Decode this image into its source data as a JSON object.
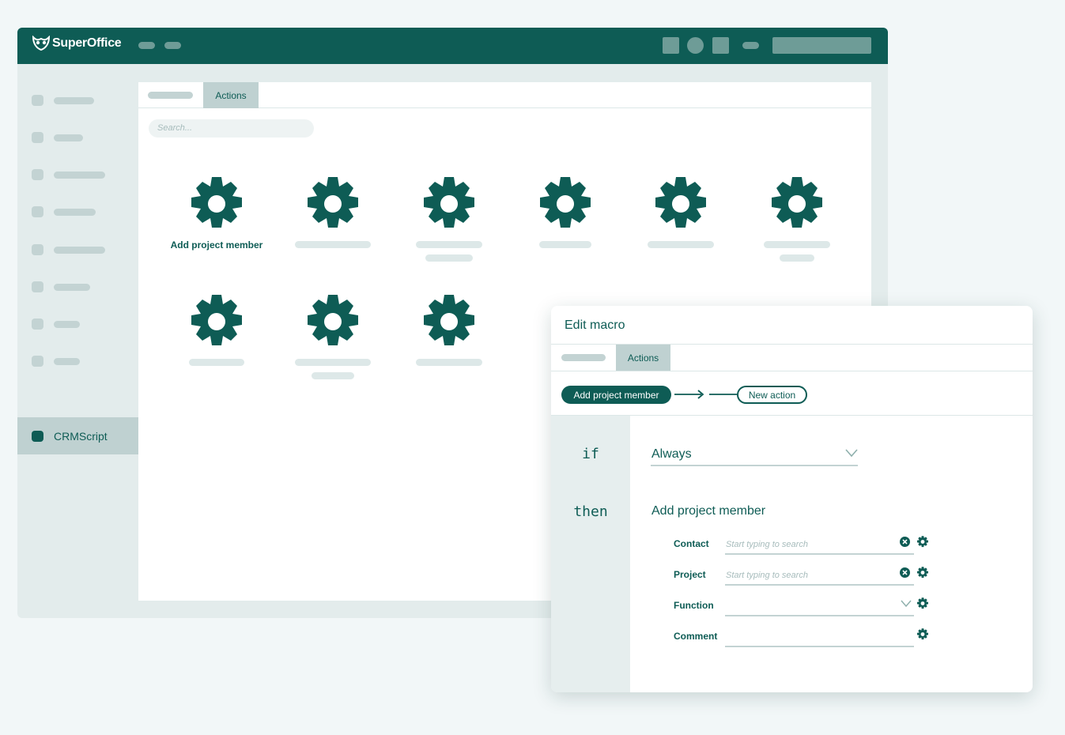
{
  "app": {
    "brand": "SuperOffice"
  },
  "sidebar": {
    "active_item": "CRMScript"
  },
  "main": {
    "tab_active": "Actions",
    "search_placeholder": "Search...",
    "tiles": [
      {
        "label": "Add project member"
      }
    ]
  },
  "dialog": {
    "title": "Edit macro",
    "tab_active": "Actions",
    "flow": {
      "current": "Add project member",
      "next": "New action"
    },
    "condition": {
      "keyword": "if",
      "value": "Always"
    },
    "action": {
      "keyword": "then",
      "title": "Add project member",
      "fields": [
        {
          "label": "Contact",
          "placeholder": "Start typing to search"
        },
        {
          "label": "Project",
          "placeholder": "Start typing to search"
        },
        {
          "label": "Function",
          "placeholder": ""
        },
        {
          "label": "Comment",
          "placeholder": ""
        }
      ]
    }
  },
  "colors": {
    "primary": "#0e5c55",
    "muted": "#c3d3d3",
    "frame": "#e3ecec",
    "background": "#f2f7f8"
  },
  "icons": {
    "tile": "gear-icon",
    "field_settings": "gear-icon",
    "field_clear": "clear-icon",
    "dropdown": "chevron-down-icon"
  }
}
